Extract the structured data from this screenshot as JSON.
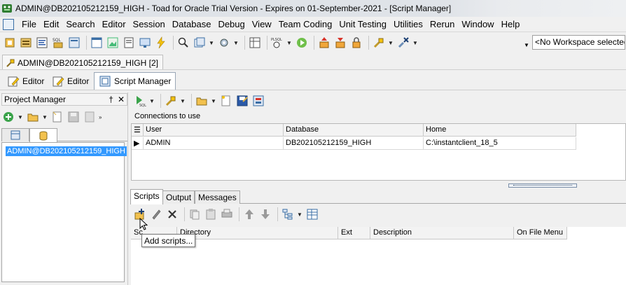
{
  "window": {
    "title": "ADMIN@DB202105212159_HIGH - Toad for Oracle Trial Version - Expires on 01-September-2021 - [Script Manager]"
  },
  "menu": {
    "items": [
      "File",
      "Edit",
      "Search",
      "Editor",
      "Session",
      "Database",
      "Debug",
      "View",
      "Team Coding",
      "Unit Testing",
      "Utilities",
      "Rerun",
      "Window",
      "Help"
    ]
  },
  "toolbar": {
    "workspace_value": "<No Workspace selected>"
  },
  "connection_tab": {
    "label": "ADMIN@DB202105212159_HIGH [2]"
  },
  "doc_tabs": [
    {
      "label": "Editor"
    },
    {
      "label": "Editor"
    },
    {
      "label": "Script Manager",
      "active": true
    }
  ],
  "project_manager": {
    "title": "Project Manager",
    "pin_glyph": "†",
    "close_glyph": "✕",
    "selected_item": "ADMIN@DB202105212159_HIGH"
  },
  "connections": {
    "label": "Connections to use",
    "columns": [
      "User",
      "Database",
      "Home"
    ],
    "rows": [
      {
        "user": "ADMIN",
        "database": "DB202105212159_HIGH",
        "home": "C:\\instantclient_18_5"
      }
    ]
  },
  "bottom_tabs": [
    "Scripts",
    "Output",
    "Messages"
  ],
  "scripts_grid": {
    "columns": [
      "Sc",
      "Directory",
      "Ext",
      "Description",
      "On File Menu"
    ]
  },
  "tooltip": {
    "text": "Add scripts..."
  },
  "colors": {
    "selection": "#3399ff",
    "titlebar": "#dfe3e8",
    "accent_blue": "#3a6ea5"
  }
}
